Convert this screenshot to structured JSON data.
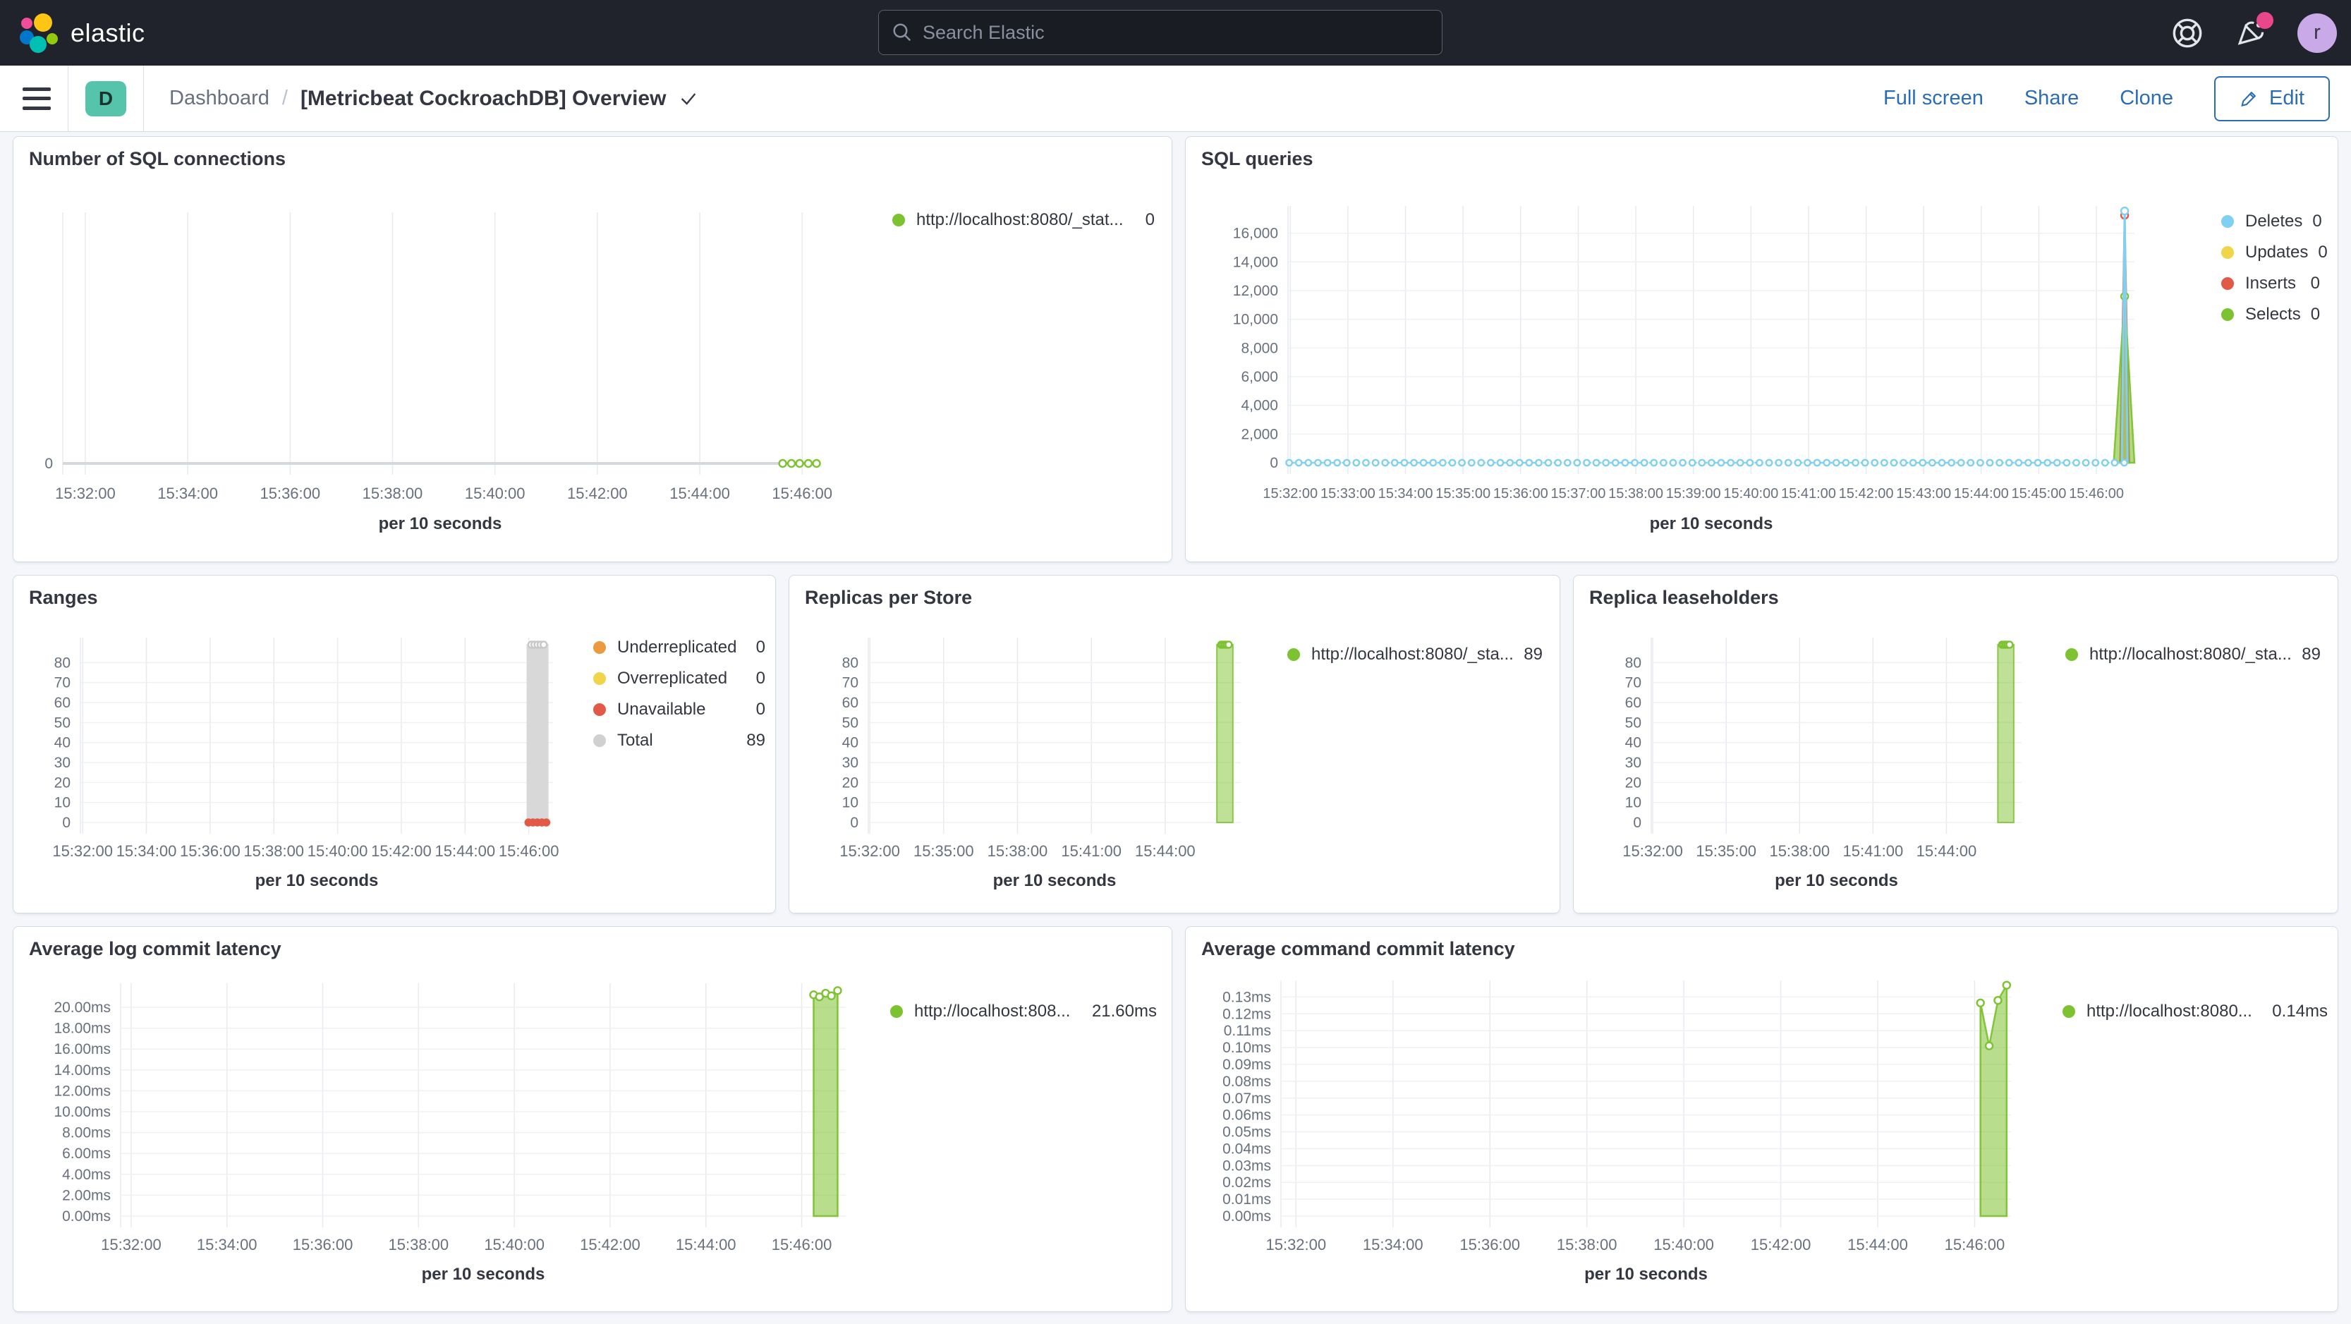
{
  "header": {
    "brand": "elastic",
    "search_placeholder": "Search Elastic",
    "avatar_initial": "r",
    "icons": [
      "help-icon",
      "newsfeed-icon",
      "user-avatar"
    ]
  },
  "toolbar": {
    "badge": "D",
    "breadcrumb_root": "Dashboard",
    "breadcrumb_sep": "/",
    "title": "[Metricbeat CockroachDB] Overview",
    "actions": {
      "full_screen": "Full screen",
      "share": "Share",
      "clone": "Clone",
      "edit": "Edit"
    }
  },
  "colors": {
    "accent_blue": "#2a6db4",
    "header_bg": "#20232c",
    "badge_teal": "#56c4ab",
    "notification_pink": "#e8478b",
    "avatar_purple": "#c9a9e8",
    "panel_border": "#d3dae6",
    "page_bg": "#f4f6fa",
    "text": "#343741",
    "subdued_text": "#69707d",
    "series_green": "#7dc230",
    "series_blue": "#7fd0f2",
    "series_yellow": "#f0d44a",
    "series_red": "#e25a46",
    "series_orange": "#ec9a3d",
    "series_gray": "#d0d0d0"
  },
  "chart_data": [
    {
      "type": "line",
      "title": "Number of SQL connections",
      "x_axis_title": "per 10 seconds",
      "x_unit": "minutes since 15:32:00",
      "x_domain": [
        -0.44,
        14.3
      ],
      "y_domain": [
        0,
        1.3
      ],
      "axis_line": true,
      "x_ticks": [
        {
          "t": 0,
          "label": "15:32:00"
        },
        {
          "t": 2,
          "label": "15:34:00"
        },
        {
          "t": 4,
          "label": "15:36:00"
        },
        {
          "t": 6,
          "label": "15:38:00"
        },
        {
          "t": 8,
          "label": "15:40:00"
        },
        {
          "t": 10,
          "label": "15:42:00"
        },
        {
          "t": 12,
          "label": "15:44:00"
        },
        {
          "t": 14,
          "label": "15:46:00"
        }
      ],
      "y_ticks": [
        {
          "v": 0,
          "label": "0"
        }
      ],
      "legend": [
        {
          "label": "http://localhost:8080/_stat...",
          "value": "0",
          "color": "#7dc230"
        }
      ],
      "series": [
        {
          "name": "http://localhost:8080/_stat...",
          "color": "#7dc230",
          "render": "dashed-markers",
          "points": [
            [
              13.62,
              0
            ],
            [
              13.79,
              0
            ],
            [
              13.95,
              0
            ],
            [
              14.12,
              0
            ],
            [
              14.28,
              0
            ]
          ]
        }
      ]
    },
    {
      "type": "area",
      "title": "SQL queries",
      "x_axis_title": "per 10 seconds",
      "x_unit": "minutes since 15:32:00",
      "x_domain": [
        -0.04,
        14.66
      ],
      "y_domain": [
        0,
        17900
      ],
      "x_ticks": [
        {
          "t": 0,
          "label": "15:32:00"
        },
        {
          "t": 1,
          "label": "15:33:00"
        },
        {
          "t": 2,
          "label": "15:34:00"
        },
        {
          "t": 3,
          "label": "15:35:00"
        },
        {
          "t": 4,
          "label": "15:36:00"
        },
        {
          "t": 5,
          "label": "15:37:00"
        },
        {
          "t": 6,
          "label": "15:38:00"
        },
        {
          "t": 7,
          "label": "15:39:00"
        },
        {
          "t": 8,
          "label": "15:40:00"
        },
        {
          "t": 9,
          "label": "15:41:00"
        },
        {
          "t": 10,
          "label": "15:42:00"
        },
        {
          "t": 11,
          "label": "15:43:00"
        },
        {
          "t": 12,
          "label": "15:44:00"
        },
        {
          "t": 13,
          "label": "15:45:00"
        },
        {
          "t": 14,
          "label": "15:46:00"
        }
      ],
      "y_ticks": [
        {
          "v": 0,
          "label": "0"
        },
        {
          "v": 2000,
          "label": "2,000"
        },
        {
          "v": 4000,
          "label": "4,000"
        },
        {
          "v": 6000,
          "label": "6,000"
        },
        {
          "v": 8000,
          "label": "8,000"
        },
        {
          "v": 10000,
          "label": "10,000"
        },
        {
          "v": 12000,
          "label": "12,000"
        },
        {
          "v": 14000,
          "label": "14,000"
        },
        {
          "v": 16000,
          "label": "16,000"
        }
      ],
      "legend": [
        {
          "label": "Deletes",
          "value": "0",
          "color": "#7fd0f2"
        },
        {
          "label": "Updates",
          "value": "0",
          "color": "#f0d44a"
        },
        {
          "label": "Inserts",
          "value": "0",
          "color": "#e25a46"
        },
        {
          "label": "Selects",
          "value": "0",
          "color": "#7dc230"
        }
      ],
      "series": [
        {
          "name": "Inserts",
          "color": "#e25a46",
          "render": "area",
          "fill_opacity": 0.45,
          "points": [
            [
              14.41,
              0
            ],
            [
              14.49,
              17250
            ],
            [
              14.57,
              0
            ]
          ],
          "markers": [
            [
              14.49,
              17250
            ]
          ]
        },
        {
          "name": "Selects",
          "color": "#7dc230",
          "render": "area",
          "fill_opacity": 0.6,
          "points": [
            [
              14.3,
              0
            ],
            [
              14.49,
              11600
            ],
            [
              14.66,
              0
            ]
          ],
          "markers": [
            [
              14.49,
              11600
            ]
          ]
        },
        {
          "name": "Deletes",
          "color": "#7fd0f2",
          "render": "line",
          "stroke_width": 3,
          "points": [
            [
              14.44,
              0
            ],
            [
              14.49,
              17550
            ],
            [
              14.54,
              0
            ]
          ],
          "markers": [
            [
              14.49,
              17550
            ]
          ]
        },
        {
          "name": "Deletes",
          "color": "#7fd0f2",
          "render": "dashed-markers",
          "gen": {
            "from": -0.02,
            "to": 14.6,
            "step": 0.1667,
            "v": 0
          },
          "marker_r": 4.2
        }
      ]
    },
    {
      "type": "bar",
      "title": "Ranges",
      "x_axis_title": "per 10 seconds",
      "x_unit": "minutes since 15:32:00",
      "x_domain": [
        -0.07,
        14.76
      ],
      "y_domain": [
        0,
        92.5
      ],
      "x_ticks": [
        {
          "t": 0,
          "label": "15:32:00"
        },
        {
          "t": 2,
          "label": "15:34:00"
        },
        {
          "t": 4,
          "label": "15:36:00"
        },
        {
          "t": 6,
          "label": "15:38:00"
        },
        {
          "t": 8,
          "label": "15:40:00"
        },
        {
          "t": 10,
          "label": "15:42:00"
        },
        {
          "t": 12,
          "label": "15:44:00"
        },
        {
          "t": 14,
          "label": "15:46:00"
        }
      ],
      "y_ticks": [
        {
          "v": 0,
          "label": "0"
        },
        {
          "v": 10,
          "label": "10"
        },
        {
          "v": 20,
          "label": "20"
        },
        {
          "v": 30,
          "label": "30"
        },
        {
          "v": 40,
          "label": "40"
        },
        {
          "v": 50,
          "label": "50"
        },
        {
          "v": 60,
          "label": "60"
        },
        {
          "v": 70,
          "label": "70"
        },
        {
          "v": 80,
          "label": "80"
        }
      ],
      "legend": [
        {
          "label": "Underreplicated",
          "value": "0",
          "color": "#ec9a3d"
        },
        {
          "label": "Overreplicated",
          "value": "0",
          "color": "#f0d44a"
        },
        {
          "label": "Unavailable",
          "value": "0",
          "color": "#e25a46"
        },
        {
          "label": "Total",
          "value": "89",
          "color": "#d0d0d0"
        }
      ],
      "series": [
        {
          "name": "Total",
          "color": "#d8d8d8",
          "render": "bar",
          "fill_opacity": 1,
          "x0": 13.95,
          "x1": 14.6,
          "v": 89,
          "top_markers": 5,
          "marker_color": "#c8c8c8"
        },
        {
          "name": "Unavailable",
          "color": "#e25a46",
          "render": "dashed-markers",
          "marker_style": "solid",
          "gen": {
            "from": 13.99,
            "to": 14.56,
            "step": 0.14,
            "v": 0
          },
          "marker_r": 4.5
        }
      ]
    },
    {
      "type": "bar",
      "title": "Replicas per Store",
      "x_axis_title": "per 10 seconds",
      "x_unit": "minutes since 15:32:00",
      "x_domain": [
        -0.06,
        15.07
      ],
      "y_domain": [
        0,
        92.5
      ],
      "x_ticks": [
        {
          "t": 0,
          "label": "15:32:00"
        },
        {
          "t": 3,
          "label": "15:35:00"
        },
        {
          "t": 6,
          "label": "15:38:00"
        },
        {
          "t": 9,
          "label": "15:41:00"
        },
        {
          "t": 12,
          "label": "15:44:00"
        }
      ],
      "y_ticks": [
        {
          "v": 0,
          "label": "0"
        },
        {
          "v": 10,
          "label": "10"
        },
        {
          "v": 20,
          "label": "20"
        },
        {
          "v": 30,
          "label": "30"
        },
        {
          "v": 40,
          "label": "40"
        },
        {
          "v": 50,
          "label": "50"
        },
        {
          "v": 60,
          "label": "60"
        },
        {
          "v": 70,
          "label": "70"
        },
        {
          "v": 80,
          "label": "80"
        }
      ],
      "legend": [
        {
          "label": "http://localhost:8080/_sta...",
          "value": "89",
          "color": "#7dc230"
        }
      ],
      "series": [
        {
          "name": "http://localhost:8080/_sta...",
          "color": "#7dc230",
          "render": "bar",
          "fill_opacity": 0.5,
          "x0": 14.1,
          "x1": 14.75,
          "v": 89,
          "top_markers": 5
        }
      ]
    },
    {
      "type": "bar",
      "title": "Replica leaseholders",
      "x_axis_title": "per 10 seconds",
      "x_unit": "minutes since 15:32:00",
      "x_domain": [
        -0.06,
        15.07
      ],
      "y_domain": [
        0,
        92.5
      ],
      "x_ticks": [
        {
          "t": 0,
          "label": "15:32:00"
        },
        {
          "t": 3,
          "label": "15:35:00"
        },
        {
          "t": 6,
          "label": "15:38:00"
        },
        {
          "t": 9,
          "label": "15:41:00"
        },
        {
          "t": 12,
          "label": "15:44:00"
        }
      ],
      "y_ticks": [
        {
          "v": 0,
          "label": "0"
        },
        {
          "v": 10,
          "label": "10"
        },
        {
          "v": 20,
          "label": "20"
        },
        {
          "v": 30,
          "label": "30"
        },
        {
          "v": 40,
          "label": "40"
        },
        {
          "v": 50,
          "label": "50"
        },
        {
          "v": 60,
          "label": "60"
        },
        {
          "v": 70,
          "label": "70"
        },
        {
          "v": 80,
          "label": "80"
        }
      ],
      "legend": [
        {
          "label": "http://localhost:8080/_sta...",
          "value": "89",
          "color": "#7dc230"
        }
      ],
      "series": [
        {
          "name": "http://localhost:8080/_sta...",
          "color": "#7dc230",
          "render": "bar",
          "fill_opacity": 0.5,
          "x0": 14.1,
          "x1": 14.75,
          "v": 89,
          "top_markers": 5
        }
      ]
    },
    {
      "type": "area",
      "title": "Average log commit latency",
      "x_axis_title": "per 10 seconds",
      "x_unit": "minutes since 15:32:00",
      "x_domain": [
        -0.22,
        14.92
      ],
      "y_domain": [
        0,
        22.3
      ],
      "x_ticks": [
        {
          "t": 0,
          "label": "15:32:00"
        },
        {
          "t": 2,
          "label": "15:34:00"
        },
        {
          "t": 4,
          "label": "15:36:00"
        },
        {
          "t": 6,
          "label": "15:38:00"
        },
        {
          "t": 8,
          "label": "15:40:00"
        },
        {
          "t": 10,
          "label": "15:42:00"
        },
        {
          "t": 12,
          "label": "15:44:00"
        },
        {
          "t": 14,
          "label": "15:46:00"
        }
      ],
      "y_ticks": [
        {
          "v": 0,
          "label": "0.00ms"
        },
        {
          "v": 2,
          "label": "2.00ms"
        },
        {
          "v": 4,
          "label": "4.00ms"
        },
        {
          "v": 6,
          "label": "6.00ms"
        },
        {
          "v": 8,
          "label": "8.00ms"
        },
        {
          "v": 10,
          "label": "10.00ms"
        },
        {
          "v": 12,
          "label": "12.00ms"
        },
        {
          "v": 14,
          "label": "14.00ms"
        },
        {
          "v": 16,
          "label": "16.00ms"
        },
        {
          "v": 18,
          "label": "18.00ms"
        },
        {
          "v": 20,
          "label": "20.00ms"
        }
      ],
      "legend": [
        {
          "label": "http://localhost:808...",
          "value": "21.60ms",
          "color": "#7dc230"
        }
      ],
      "series": [
        {
          "name": "http://localhost:808...",
          "color": "#7dc230",
          "render": "area",
          "fill_opacity": 0.55,
          "points": [
            [
              14.25,
              21.2
            ],
            [
              14.37,
              21.0
            ],
            [
              14.5,
              21.35
            ],
            [
              14.62,
              21.1
            ],
            [
              14.75,
              21.6
            ]
          ],
          "markers": "all"
        }
      ]
    },
    {
      "type": "area",
      "title": "Average command commit latency",
      "x_axis_title": "per 10 seconds",
      "x_unit": "minutes since 15:32:00",
      "x_domain": [
        -0.31,
        14.75
      ],
      "y_domain": [
        0,
        0.1398
      ],
      "x_ticks": [
        {
          "t": 0,
          "label": "15:32:00"
        },
        {
          "t": 2,
          "label": "15:34:00"
        },
        {
          "t": 4,
          "label": "15:36:00"
        },
        {
          "t": 6,
          "label": "15:38:00"
        },
        {
          "t": 8,
          "label": "15:40:00"
        },
        {
          "t": 10,
          "label": "15:42:00"
        },
        {
          "t": 12,
          "label": "15:44:00"
        },
        {
          "t": 14,
          "label": "15:46:00"
        }
      ],
      "y_ticks": [
        {
          "v": 0,
          "label": "0.00ms"
        },
        {
          "v": 0.01,
          "label": "0.01ms"
        },
        {
          "v": 0.02,
          "label": "0.02ms"
        },
        {
          "v": 0.03,
          "label": "0.03ms"
        },
        {
          "v": 0.04,
          "label": "0.04ms"
        },
        {
          "v": 0.05,
          "label": "0.05ms"
        },
        {
          "v": 0.06,
          "label": "0.06ms"
        },
        {
          "v": 0.07,
          "label": "0.07ms"
        },
        {
          "v": 0.08,
          "label": "0.08ms"
        },
        {
          "v": 0.09,
          "label": "0.09ms"
        },
        {
          "v": 0.1,
          "label": "0.10ms"
        },
        {
          "v": 0.11,
          "label": "0.11ms"
        },
        {
          "v": 0.12,
          "label": "0.12ms"
        },
        {
          "v": 0.13,
          "label": "0.13ms"
        }
      ],
      "legend": [
        {
          "label": "http://localhost:8080...",
          "value": "0.14ms",
          "color": "#7dc230"
        }
      ],
      "series": [
        {
          "name": "http://localhost:8080...",
          "color": "#7dc230",
          "render": "area",
          "fill_opacity": 0.55,
          "points": [
            [
              14.12,
              0.1265
            ],
            [
              14.3,
              0.101
            ],
            [
              14.48,
              0.128
            ],
            [
              14.66,
              0.137
            ]
          ],
          "markers": "all"
        }
      ]
    }
  ]
}
